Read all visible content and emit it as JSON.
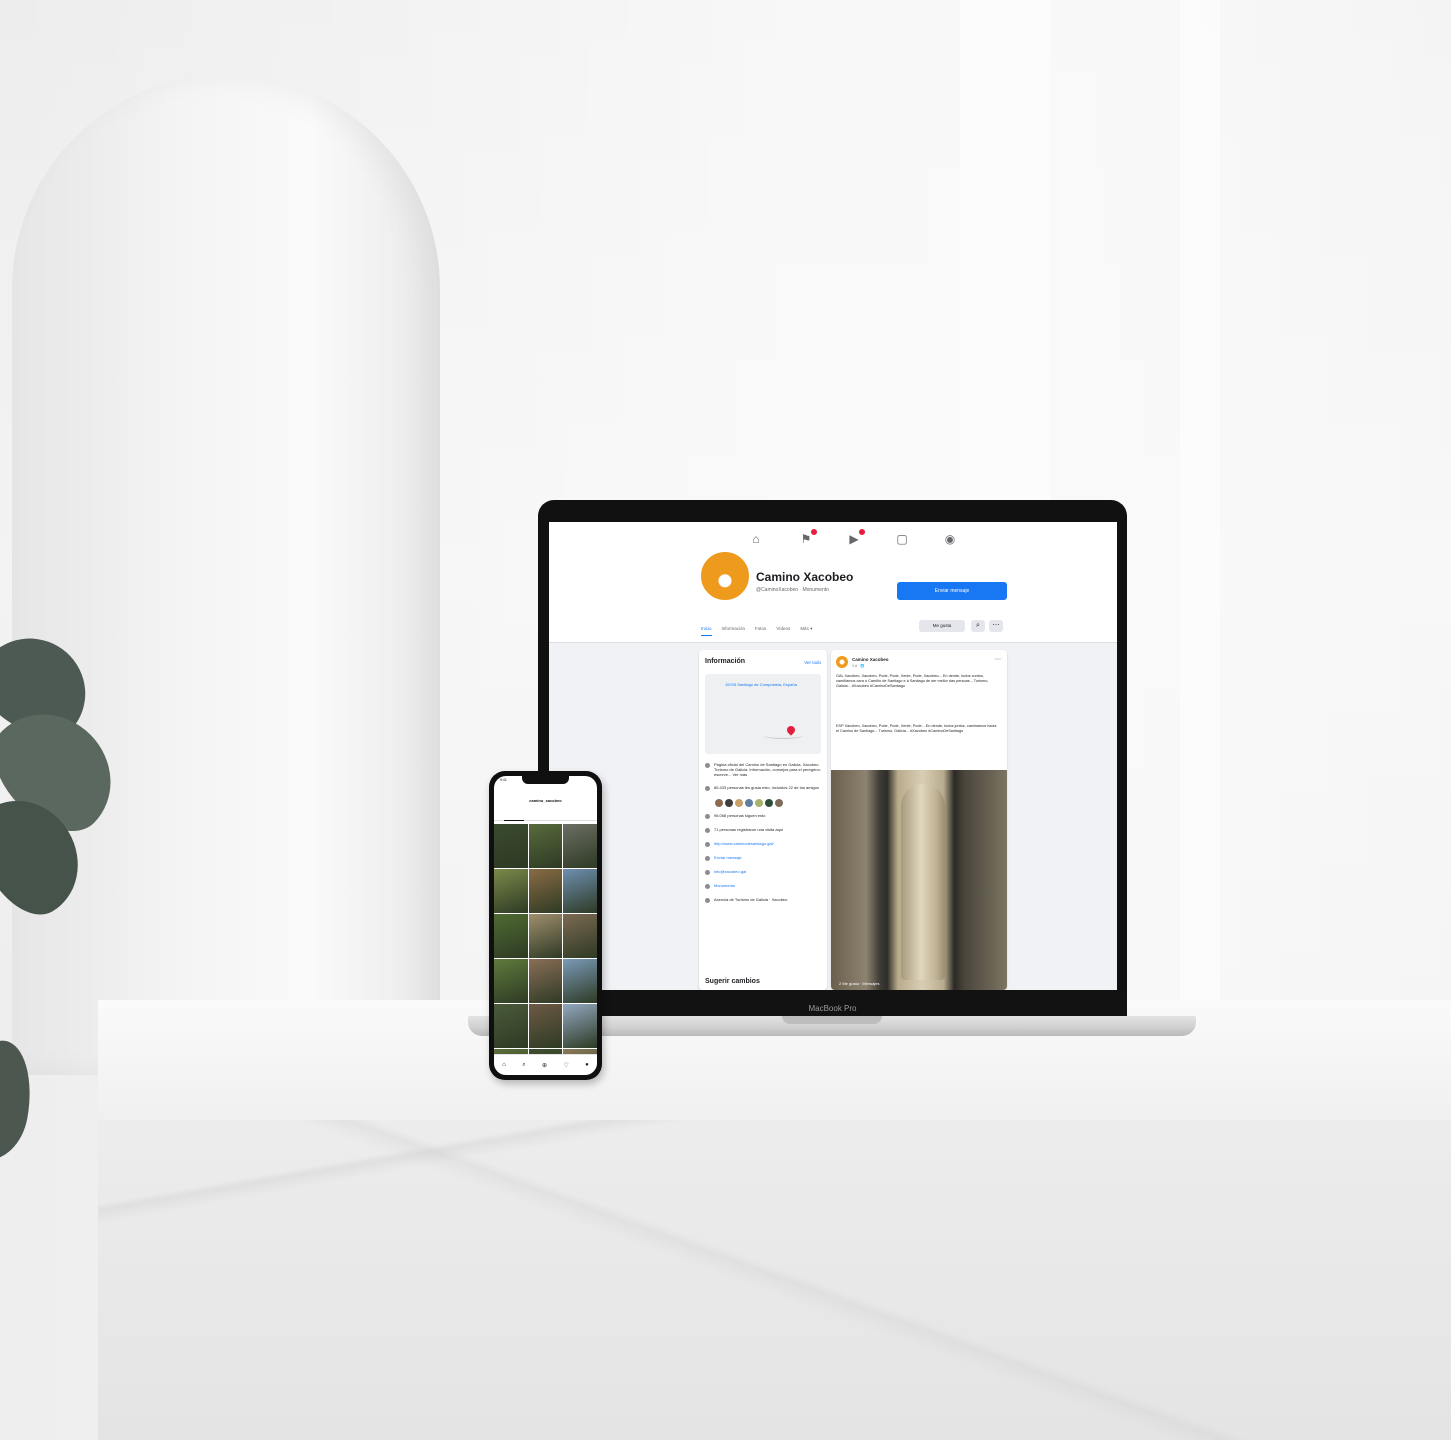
{
  "facebook": {
    "page_name": "Camino Xacobeo",
    "handle": "@CaminoXacobeo · Monumento",
    "send_button": "Enviar mensaje",
    "tabs": [
      "Inicio",
      "Información",
      "Fotos",
      "Vídeos",
      "Más ▾"
    ],
    "like_button": "Me gusta",
    "nav_icons": [
      "home-icon",
      "flag-icon",
      "video-icon",
      "store-icon",
      "groups-icon"
    ],
    "info": {
      "title": "Información",
      "see_all": "Ver todo",
      "address": "15705 Santiago de Compostela, España",
      "rows": [
        {
          "icon": "info-icon",
          "text": "Página oficial del Camino de Santiago en Galicia. Xacobeo Turismo de Galicia. Información, consejos para el peregrino: escreve... Ver más",
          "link": false
        },
        {
          "icon": "like-icon",
          "text": "85.433 personas les gusta esto, incluidos 22 de tus amigos",
          "link": false
        },
        {
          "icon": "followers-icon",
          "text": "96.058 personas siguen esto",
          "link": false
        },
        {
          "icon": "checkin-icon",
          "text": "71 personas registraron una visita aquí",
          "link": false
        },
        {
          "icon": "web-icon",
          "text": "http://www.caminodesantiago.gal/",
          "link": true
        },
        {
          "icon": "messenger-icon",
          "text": "Enviar mensaje",
          "link": true
        },
        {
          "icon": "email-icon",
          "text": "info@xacobeo.gal",
          "link": true
        },
        {
          "icon": "category-icon",
          "text": "Monumento",
          "link": true
        },
        {
          "icon": "admin-icon",
          "text": "Axencia de Turismo de Galicia · Xacobeo",
          "link": false
        }
      ],
      "suggest": "Sugerir cambios"
    },
    "post": {
      "author": "Camino Xacobeo",
      "meta": "1 d · 🌐",
      "text_gl": "GAL Xacobeo, Xacobeo, Pode, Pode, Xente, Pode, Xacobeo... En dende, todos xuntos, camiñamos cara o Camiño de Santiago e á Santiago de ser mellor das persoas... Turismo, Galicia... #Xacobeo #CaminoDeSantiago",
      "text_es": "ESP Xacobeo, Xacobeo, Pode, Pode, Xente, Pode... En dende, todos juntos, caminamos hacia el Camino de Santiago... Turismo, Galicia... #Xacobeo #CaminoDeSantiago",
      "messages": "2 Me gusta · Mensajes"
    }
  },
  "laptop_label": "MacBook Pro",
  "phone": {
    "status_time": "9:41",
    "profile_handle": "camino_xacobeo",
    "bottom_icons": [
      "home-icon",
      "search-icon",
      "add-icon",
      "heart-icon",
      "profile-icon"
    ],
    "tile_colors": [
      "#3a4a2e",
      "#586b3c",
      "#6b6e64",
      "#7a8a4a",
      "#8a6b44",
      "#6d8fb0",
      "#4f6b32",
      "#a08e6e",
      "#7c6a52",
      "#5f7a3c",
      "#8a6e58",
      "#7a9ab8",
      "#4a5a3a",
      "#6e5a44",
      "#92a8c0",
      "#5a6e3a",
      "#3e4e2e",
      "#8a7a5a"
    ]
  },
  "colors": {
    "brand_orange": "#ee9a1d",
    "fb_blue": "#1877f2",
    "fb_bg": "#f0f2f5"
  }
}
